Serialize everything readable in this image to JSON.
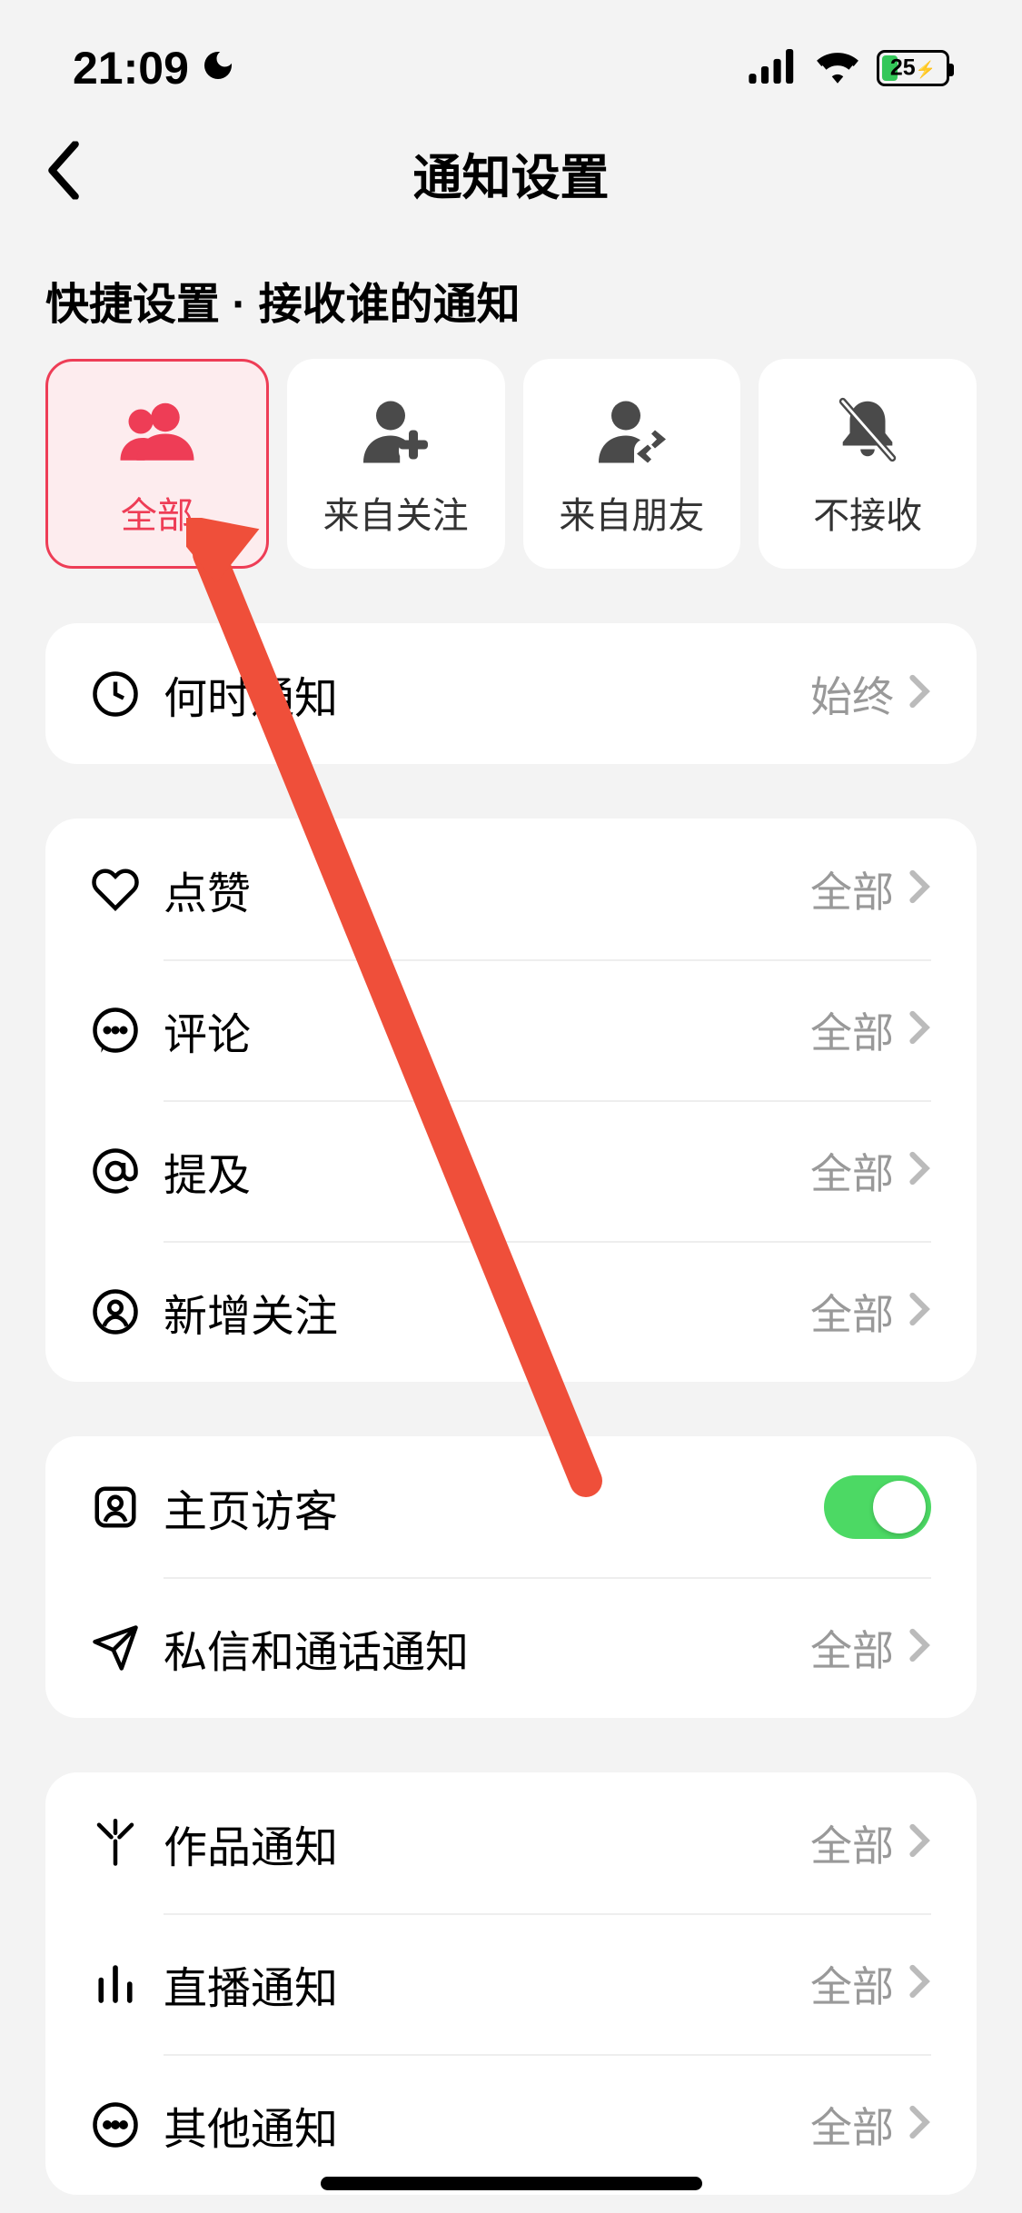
{
  "status": {
    "time": "21:09",
    "battery_pct": "25",
    "battery_charging": true
  },
  "header": {
    "title": "通知设置"
  },
  "quick": {
    "section_label": "快捷设置 · 接收谁的通知",
    "items": [
      {
        "label": "全部",
        "icon": "group-icon",
        "selected": true
      },
      {
        "label": "来自关注",
        "icon": "follow-add-icon",
        "selected": false
      },
      {
        "label": "来自朋友",
        "icon": "friend-swap-icon",
        "selected": false
      },
      {
        "label": "不接收",
        "icon": "bell-off-icon",
        "selected": false
      }
    ]
  },
  "groups": [
    {
      "rows": [
        {
          "icon": "clock-icon",
          "label": "何时通知",
          "value": "始终",
          "type": "nav"
        }
      ]
    },
    {
      "rows": [
        {
          "icon": "heart-icon",
          "label": "点赞",
          "value": "全部",
          "type": "nav"
        },
        {
          "icon": "comment-icon",
          "label": "评论",
          "value": "全部",
          "type": "nav"
        },
        {
          "icon": "at-icon",
          "label": "提及",
          "value": "全部",
          "type": "nav"
        },
        {
          "icon": "user-circle-icon",
          "label": "新增关注",
          "value": "全部",
          "type": "nav"
        }
      ]
    },
    {
      "rows": [
        {
          "icon": "profile-card-icon",
          "label": "主页访客",
          "value": "",
          "type": "toggle",
          "on": true
        },
        {
          "icon": "send-icon",
          "label": "私信和通话通知",
          "value": "全部",
          "type": "nav"
        }
      ]
    },
    {
      "rows": [
        {
          "icon": "sparkle-icon",
          "label": "作品通知",
          "value": "全部",
          "type": "nav"
        },
        {
          "icon": "bars-icon",
          "label": "直播通知",
          "value": "全部",
          "type": "nav"
        },
        {
          "icon": "more-circle-icon",
          "label": "其他通知",
          "value": "全部",
          "type": "nav"
        }
      ]
    }
  ]
}
